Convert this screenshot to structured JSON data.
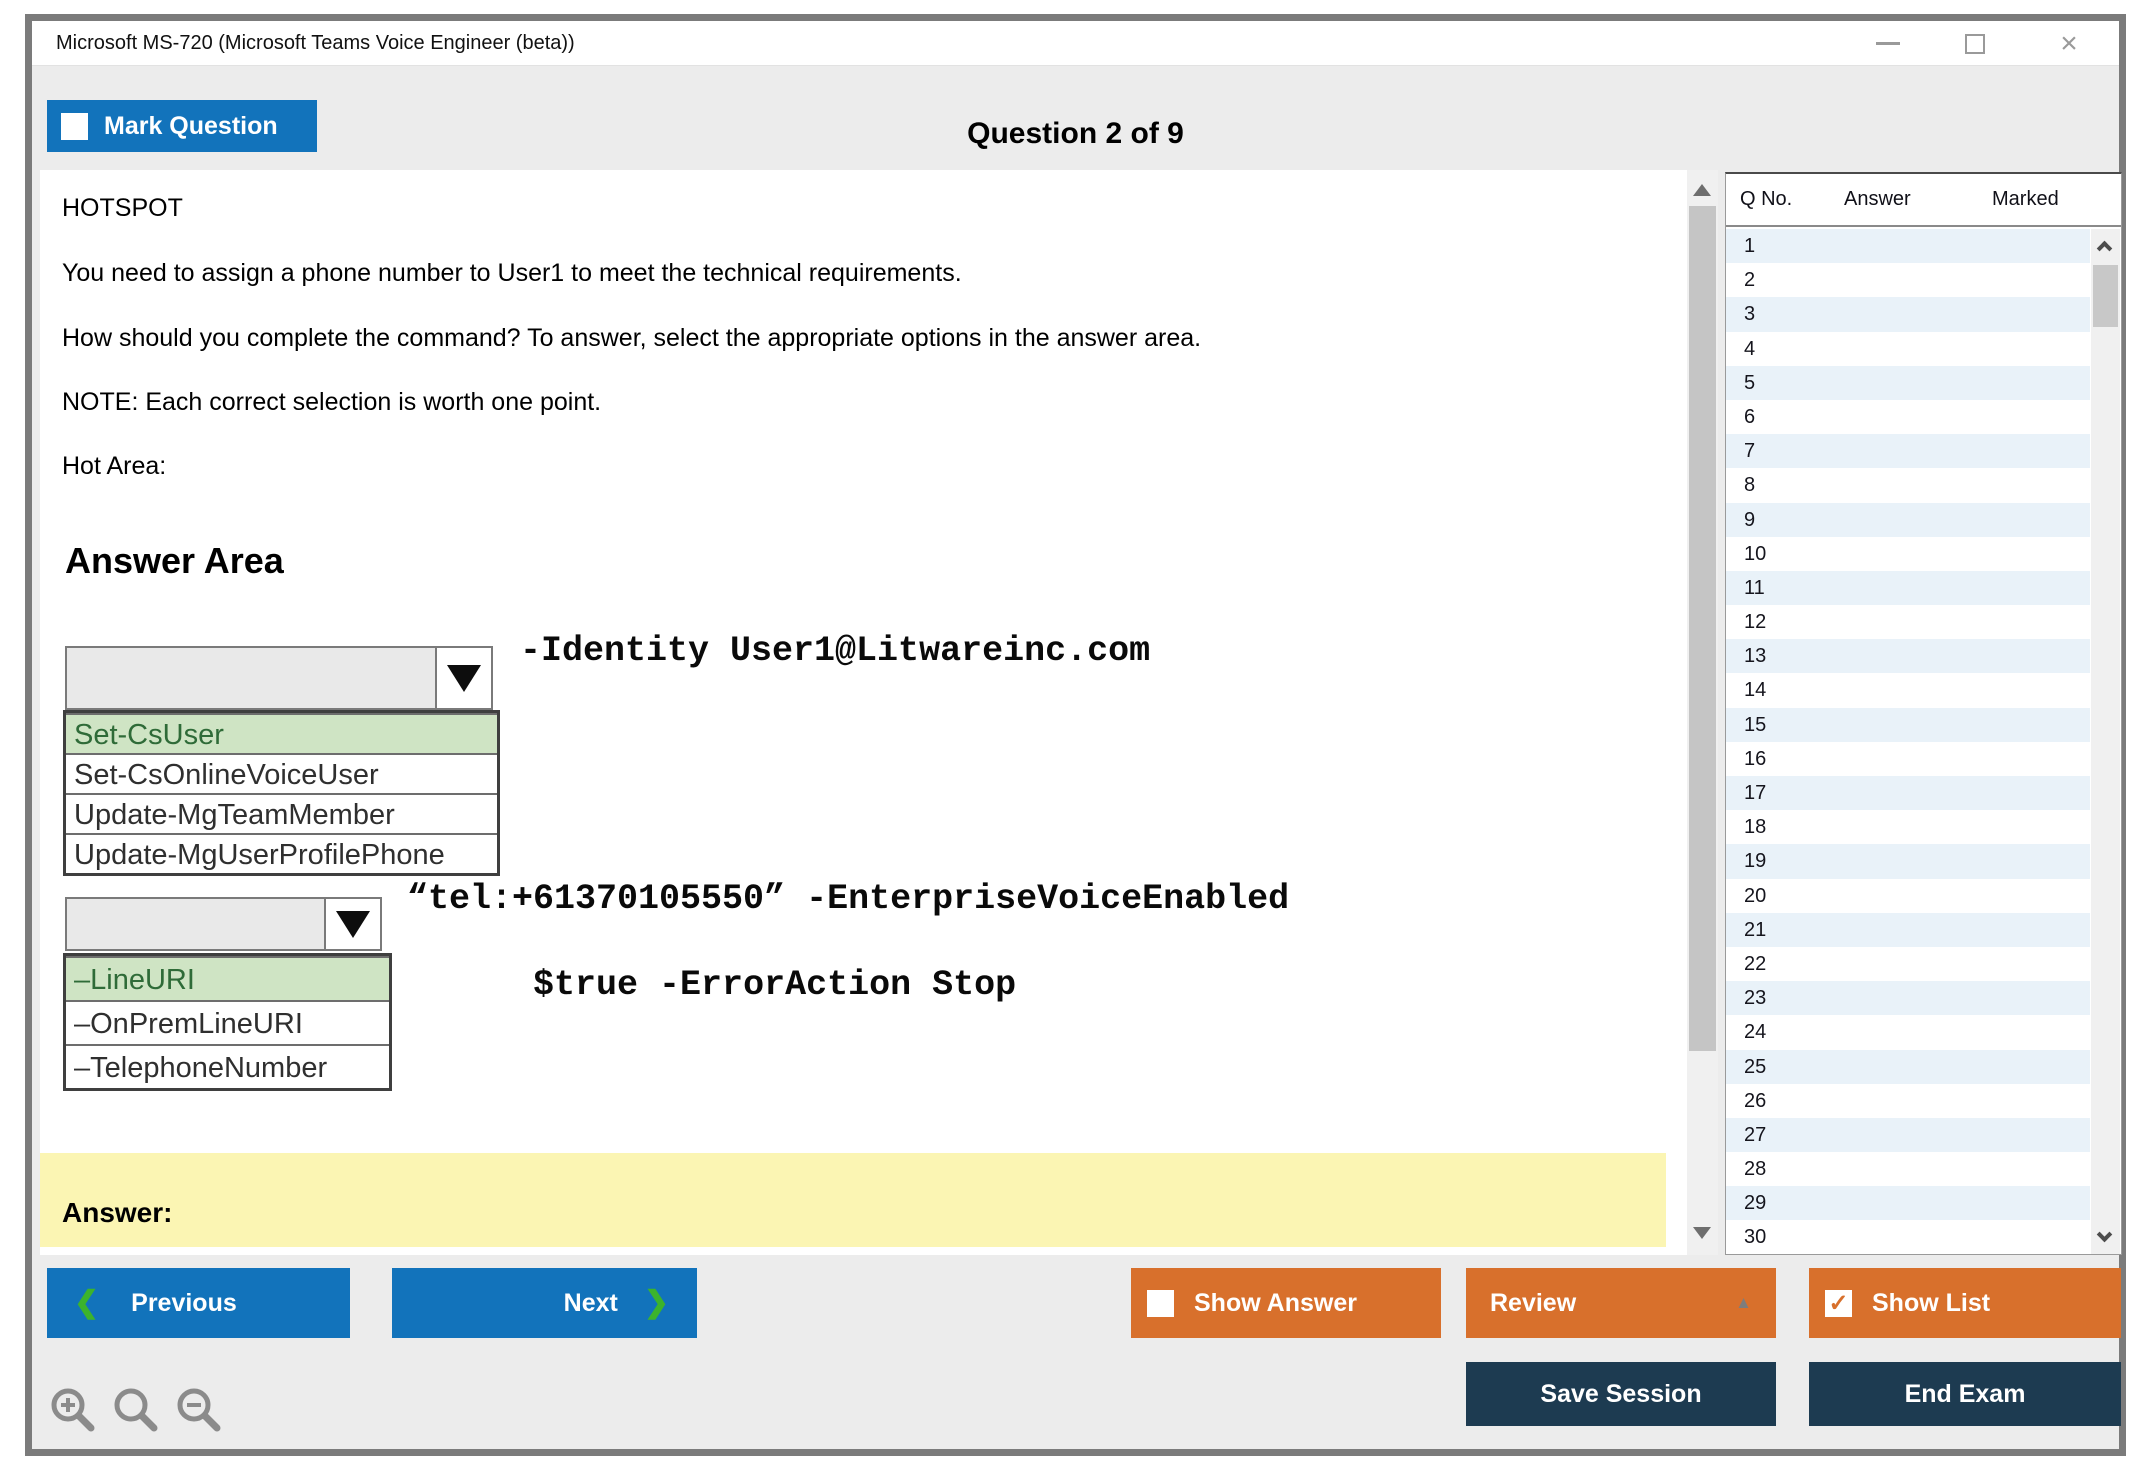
{
  "window": {
    "title": "Microsoft MS-720 (Microsoft Teams Voice Engineer (beta))",
    "controls": {
      "close_glyph": "×"
    }
  },
  "header": {
    "mark_question": "Mark Question",
    "counter": "Question 2 of 9"
  },
  "question": {
    "kind": "HOTSPOT",
    "p1": "You need to assign a phone number to User1 to meet the technical requirements.",
    "p2": "How should you complete the command? To answer, select the appropriate options in the answer area.",
    "p3": "NOTE: Each correct selection is worth one point.",
    "hot_area": "Hot Area:",
    "answer_area_title": "Answer Area",
    "answer_label": "Answer:",
    "dropdown1": {
      "selected_index": 0,
      "options": [
        "Set-CsUser",
        "Set-CsOnlineVoiceUser",
        "Update-MgTeamMember",
        "Update-MgUserProfilePhone"
      ],
      "command": "-Identity User1@Litwareinc.com"
    },
    "dropdown2": {
      "selected_index": 0,
      "options": [
        "–LineURI",
        "–OnPremLineURI",
        "–TelephoneNumber"
      ],
      "command_line1": "“tel:+61370105550” -EnterpriseVoiceEnabled",
      "command_line2": "$true -ErrorAction Stop"
    }
  },
  "question_list": {
    "headers": [
      "Q No.",
      "Answer",
      "Marked"
    ],
    "rows": [
      "1",
      "2",
      "3",
      "4",
      "5",
      "6",
      "7",
      "8",
      "9",
      "10",
      "11",
      "12",
      "13",
      "14",
      "15",
      "16",
      "17",
      "18",
      "19",
      "20",
      "21",
      "22",
      "23",
      "24",
      "25",
      "26",
      "27",
      "28",
      "29",
      "30"
    ]
  },
  "toolbar": {
    "previous": "Previous",
    "next": "Next",
    "show_answer": "Show Answer",
    "review": "Review",
    "show_list": "Show List",
    "save_session": "Save Session",
    "end_exam": "End Exam",
    "prev_chevron": "❮",
    "next_chevron": "❯",
    "review_arrow": "▲",
    "show_list_check": "✓"
  },
  "colors": {
    "accent_blue": "#1273bb",
    "accent_orange": "#d8702c",
    "accent_navy": "#1d3b51",
    "chevron_green": "#3cb32c",
    "highlight_green": "#cfe4c4",
    "highlight_green_text": "#2f6b38",
    "answer_bar_yellow": "#fbf5b3",
    "row_alt_blue": "#e9f2f9"
  }
}
